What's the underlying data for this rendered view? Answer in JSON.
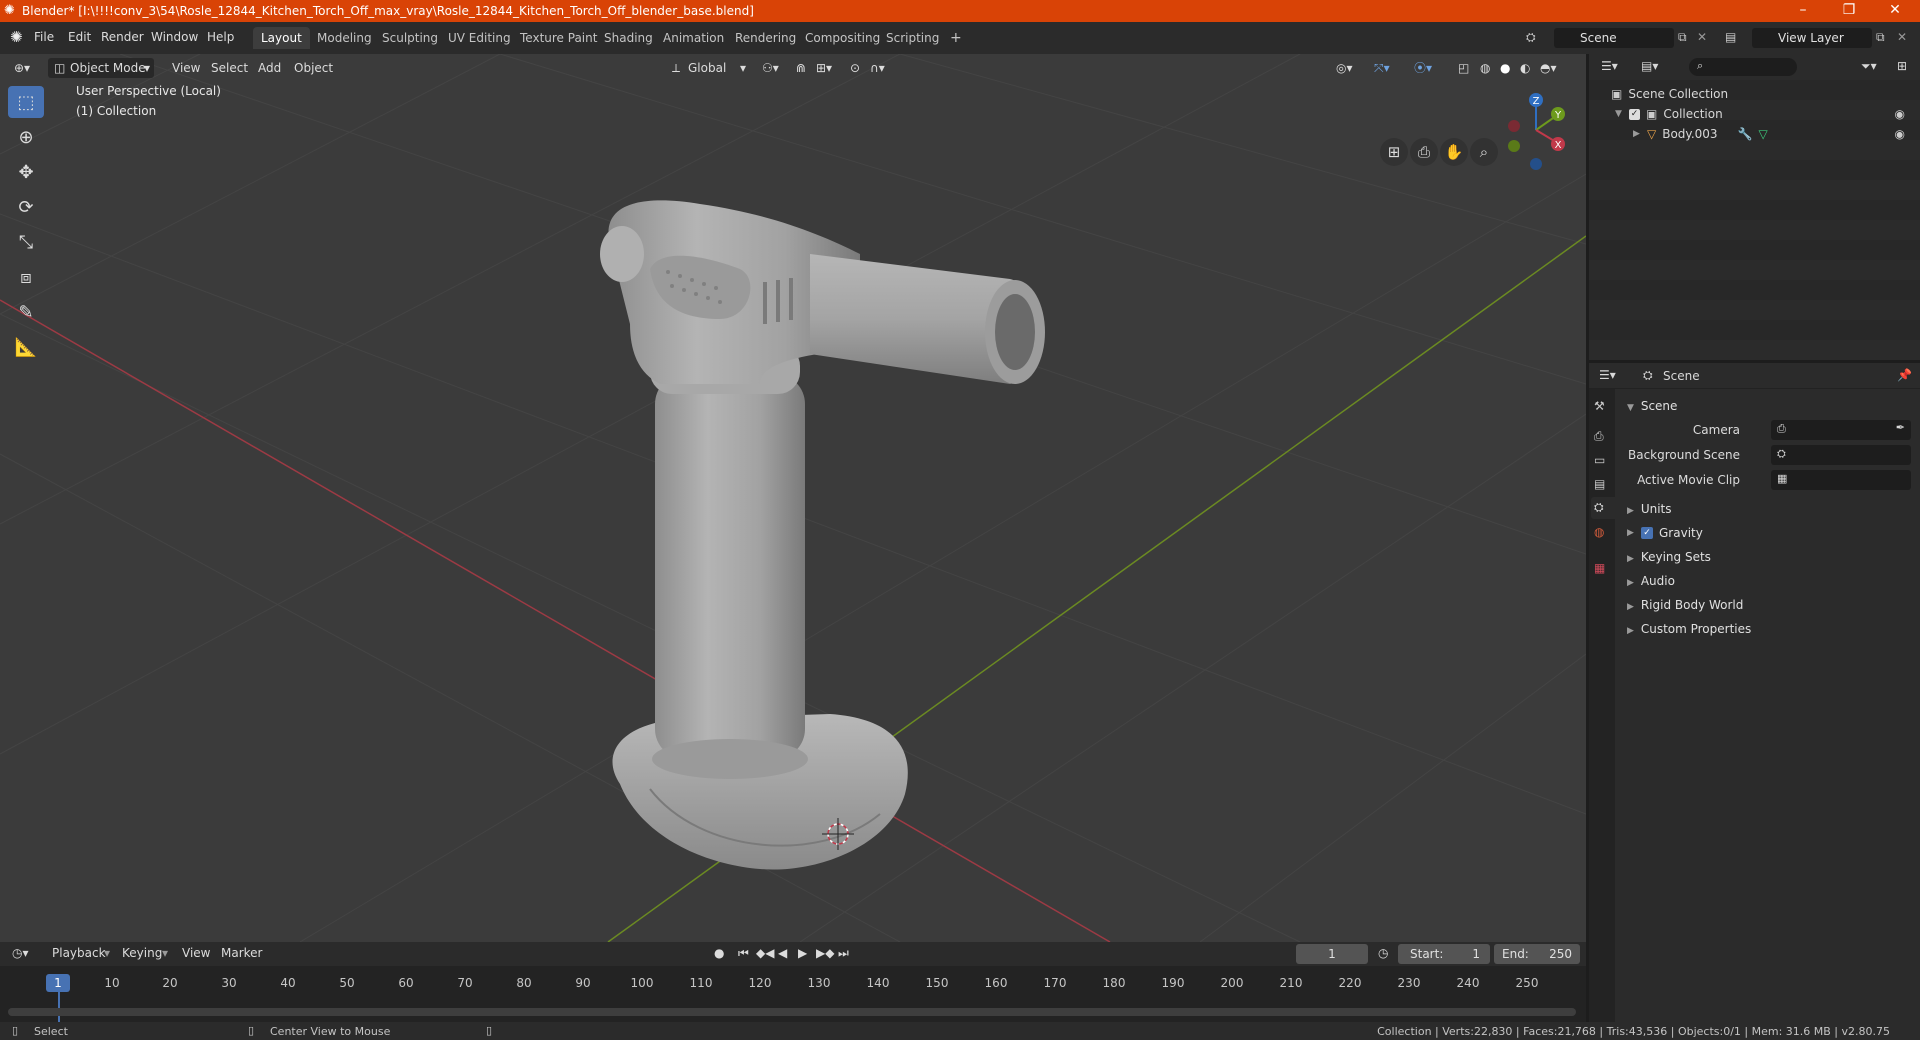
{
  "titlebar": {
    "title": "Blender* [I:\\!!!!conv_3\\54\\Rosle_12844_Kitchen_Torch_Off_max_vray\\Rosle_12844_Kitchen_Torch_Off_blender_base.blend]",
    "minimize": "–",
    "maximize": "❐",
    "close": "✕"
  },
  "menus": [
    "File",
    "Edit",
    "Render",
    "Window",
    "Help"
  ],
  "workspaces": [
    "Layout",
    "Modeling",
    "Sculpting",
    "UV Editing",
    "Texture Paint",
    "Shading",
    "Animation",
    "Rendering",
    "Compositing",
    "Scripting",
    "+"
  ],
  "scene_field": "Scene",
  "view_layer_field": "View Layer",
  "viewport": {
    "mode": "Object Mode",
    "menus": [
      "View",
      "Select",
      "Add",
      "Object"
    ],
    "transform": "Global",
    "perspective": "User Perspective (Local)",
    "collection": "(1) Collection",
    "gizmo": {
      "z": "Z",
      "y": "Y",
      "x": "X"
    }
  },
  "timeline": {
    "menus": [
      "Playback",
      "Keying",
      "View",
      "Marker"
    ],
    "current_frame": "1",
    "start_label": "Start:",
    "start": "1",
    "end_label": "End:",
    "end": "250",
    "ticks": [
      "1",
      "10",
      "20",
      "30",
      "40",
      "50",
      "60",
      "70",
      "80",
      "90",
      "100",
      "110",
      "120",
      "130",
      "140",
      "150",
      "160",
      "170",
      "180",
      "190",
      "200",
      "210",
      "220",
      "230",
      "240",
      "250"
    ]
  },
  "statusbar": {
    "select": "Select",
    "center": "Center View to Mouse",
    "stats": "Collection | Verts:22,830 | Faces:21,768 | Tris:43,536 | Objects:0/1 | Mem: 31.6 MB | v2.80.75"
  },
  "outliner": {
    "root": "Scene Collection",
    "collection": "Collection",
    "object": "Body.003"
  },
  "properties": {
    "header": "Scene",
    "section": "Scene",
    "camera_label": "Camera",
    "bg_scene_label": "Background Scene",
    "movie_clip_label": "Active Movie Clip",
    "subsections": [
      "Units",
      "Gravity",
      "Keying Sets",
      "Audio",
      "Rigid Body World",
      "Custom Properties"
    ]
  },
  "colors": {
    "titlebar": "#d94306",
    "active_tool": "#4772b3",
    "axis_x": "#c1394a",
    "axis_y": "#6d9a1d",
    "axis_z": "#2f6fc2"
  }
}
